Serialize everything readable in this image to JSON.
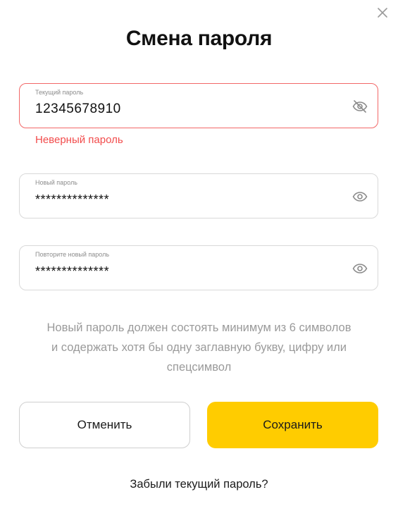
{
  "dialog": {
    "title": "Смена пароля",
    "close_icon": "close-icon"
  },
  "fields": {
    "current": {
      "label": "Текущий пароль",
      "value": "12345678910",
      "icon": "eye-off-icon",
      "error": "Неверный пароль"
    },
    "new": {
      "label": "Новый пароль",
      "value": "**************",
      "icon": "eye-icon"
    },
    "repeat": {
      "label": "Повторите новый пароль",
      "value": "**************",
      "icon": "eye-icon"
    }
  },
  "hint": {
    "line1": "Новый пароль должен состоять минимум из 6 символов",
    "line2": "и содержать хотя бы одну заглавную букву, цифру или",
    "line3": "спецсимвол"
  },
  "buttons": {
    "cancel_label": "Отменить",
    "save_label": "Сохранить"
  },
  "forgot_link": "Забыли текущий пароль?",
  "colors": {
    "accent": "#ffcc00",
    "error": "#f24c4c",
    "error_border": "#f26868",
    "hint": "#9a9a9a"
  }
}
